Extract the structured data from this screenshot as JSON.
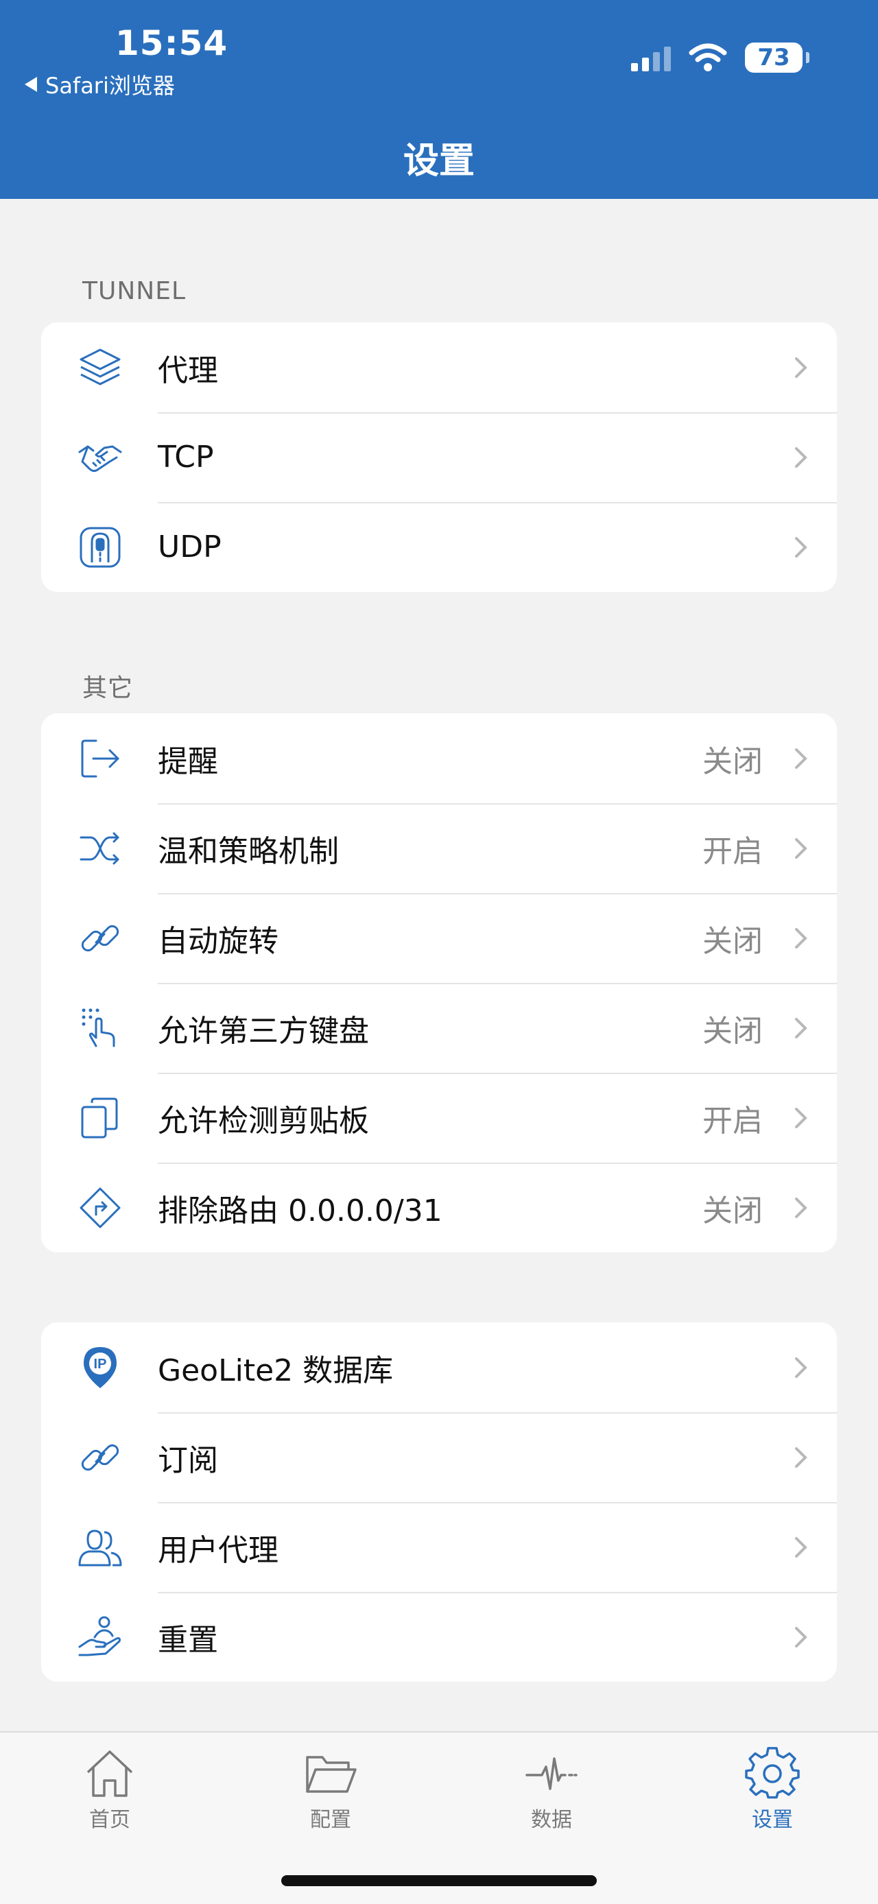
{
  "status_bar": {
    "time": "15:54",
    "back_label": "Safari浏览器",
    "battery": "73"
  },
  "header": {
    "title": "设置"
  },
  "sections": [
    {
      "label": "TUNNEL",
      "items": [
        {
          "label": "代理",
          "value": null,
          "icon": "layers-icon"
        },
        {
          "label": "TCP",
          "value": null,
          "icon": "handshake-icon"
        },
        {
          "label": "UDP",
          "value": null,
          "icon": "udp-icon"
        }
      ]
    },
    {
      "label": "其它",
      "items": [
        {
          "label": "提醒",
          "value": "关闭",
          "icon": "exit-arrow-icon"
        },
        {
          "label": "温和策略机制",
          "value": "开启",
          "icon": "shuffle-icon"
        },
        {
          "label": "自动旋转",
          "value": "关闭",
          "icon": "link-icon"
        },
        {
          "label": "允许第三方键盘",
          "value": "关闭",
          "icon": "tap-keyboard-icon"
        },
        {
          "label": "允许检测剪贴板",
          "value": "开启",
          "icon": "copy-icon"
        },
        {
          "label": "排除路由 0.0.0.0/31",
          "value": "关闭",
          "icon": "route-sign-icon"
        }
      ]
    },
    {
      "label": "",
      "items": [
        {
          "label": "GeoLite2 数据库",
          "value": null,
          "icon": "ip-pin-icon"
        },
        {
          "label": "订阅",
          "value": null,
          "icon": "link-icon"
        },
        {
          "label": "用户代理",
          "value": null,
          "icon": "users-icon"
        },
        {
          "label": "重置",
          "value": null,
          "icon": "hand-coin-icon"
        }
      ]
    }
  ],
  "tabbar": {
    "tabs": [
      {
        "label": "首页",
        "icon": "home-icon",
        "active": false
      },
      {
        "label": "配置",
        "icon": "folder-icon",
        "active": false
      },
      {
        "label": "数据",
        "icon": "pulse-icon",
        "active": false
      },
      {
        "label": "设置",
        "icon": "gear-icon",
        "active": true
      }
    ]
  },
  "colors": {
    "accent": "#2a6fbd",
    "background": "#f2f2f2",
    "card": "#ffffff",
    "secondary_text": "#8a8a8a"
  }
}
